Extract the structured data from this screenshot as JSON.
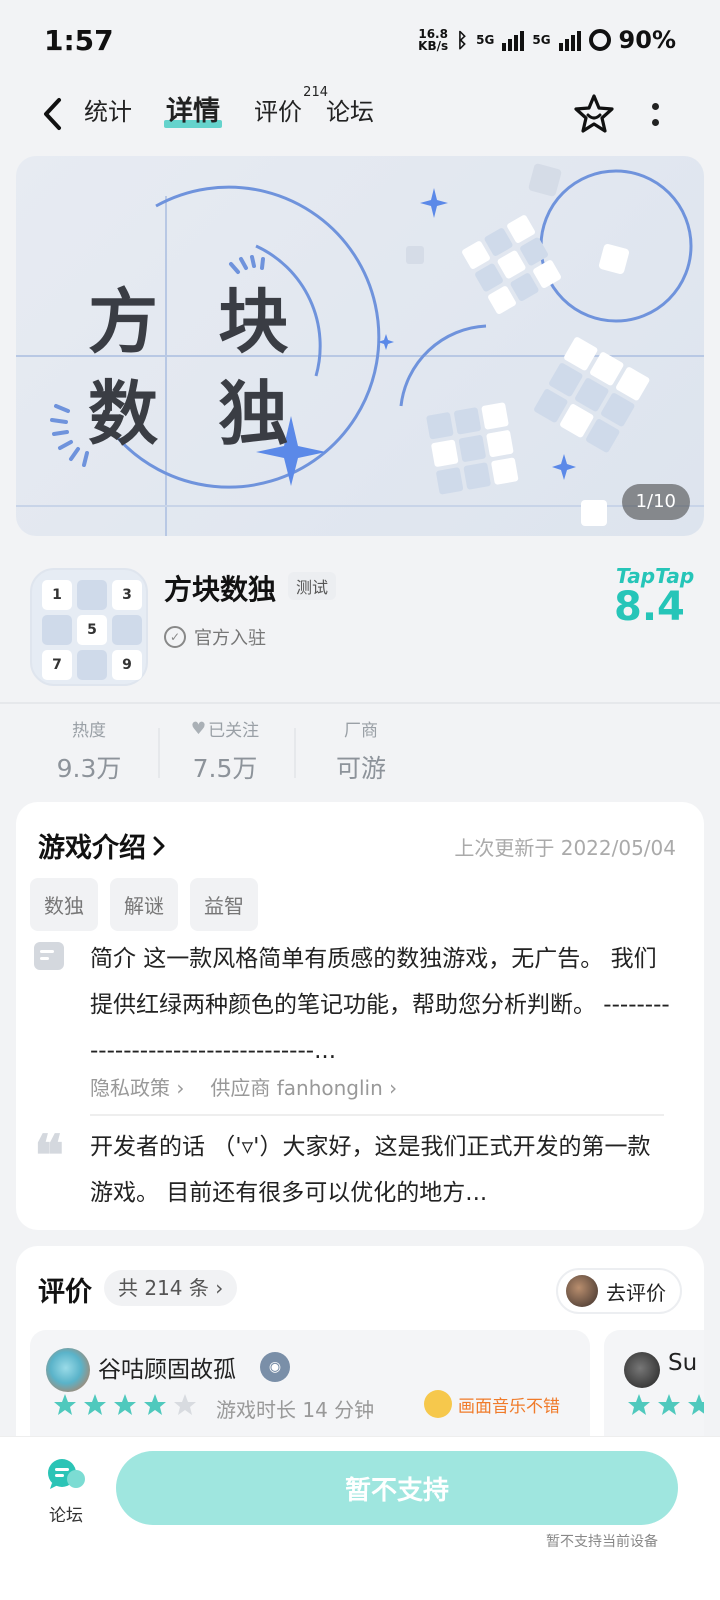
{
  "status": {
    "time": "1:57",
    "net_speed_value": "16.8",
    "net_speed_unit": "KB/s",
    "network_1": "5G",
    "network_2": "5G",
    "battery": "90%"
  },
  "nav": {
    "tabs": [
      {
        "label": "统计"
      },
      {
        "label": "详情"
      },
      {
        "label": "评价",
        "badge": "214"
      },
      {
        "label": "论坛"
      }
    ],
    "active_tab": "详情"
  },
  "banner": {
    "title_line1": "方 块",
    "title_line2": "数 独",
    "counter": "1/10"
  },
  "app": {
    "name": "方块数独",
    "tag": "测试",
    "official": "官方入驻",
    "rating_source": "TapTap",
    "rating": "8.4",
    "icon_numbers": [
      "1",
      "",
      "3",
      "",
      "5",
      "",
      "7",
      "",
      "9"
    ]
  },
  "stats": {
    "items": [
      {
        "label": "热度",
        "value": "9.3万"
      },
      {
        "label": "已关注",
        "value": "7.5万"
      },
      {
        "label": "厂商",
        "value": "可游"
      }
    ]
  },
  "intro": {
    "title": "游戏介绍",
    "updated": "上次更新于 2022/05/04",
    "tags": [
      "数独",
      "解谜",
      "益智"
    ],
    "summary": "简介 这一款风格简单有质感的数独游戏，无广告。 我们提供红绿两种颜色的笔记功能，帮助您分析判断。 -----------------------------------...",
    "privacy_link": "隐私政策",
    "supplier_link": "供应商 fanhonglin",
    "developer_note": "开发者的话 （'▿'）大家好，这是我们正式开发的第一款游戏。 目前还有很多可以优化的地方..."
  },
  "reviews": {
    "title": "评价",
    "count": "共 214 条",
    "go_review": "去评价",
    "items": [
      {
        "user": "谷咕顾固故孤",
        "stars": 4,
        "playtime": "游戏时长 14 分钟",
        "tag": "画面音乐不错"
      },
      {
        "user": "Su",
        "stars": 3
      }
    ]
  },
  "bottom": {
    "forum": "论坛",
    "cta": "暂不支持",
    "cta_note": "暂不支持当前设备"
  },
  "colors": {
    "accent": "#26c5b8",
    "cta": "#9fe6df",
    "star": "#4fc9bd"
  }
}
